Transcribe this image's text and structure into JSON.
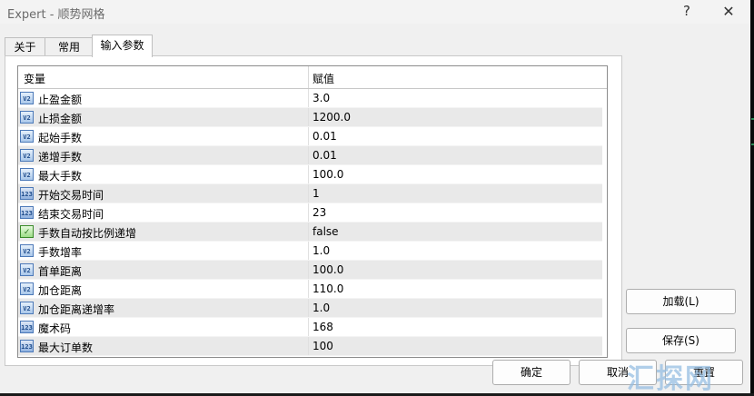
{
  "window": {
    "title": "Expert - 顺势网格",
    "help_glyph": "?",
    "close_glyph": "✕"
  },
  "tabs": [
    {
      "label": "关于"
    },
    {
      "label": "常用"
    },
    {
      "label": "输入参数",
      "active": true
    }
  ],
  "table": {
    "columns": [
      "变量",
      "赋值"
    ],
    "rows": [
      {
        "icon": "double-type-icon",
        "icon_text": "V2",
        "name": "止盈金额",
        "value": "3.0"
      },
      {
        "icon": "double-type-icon",
        "icon_text": "V2",
        "name": "止损金额",
        "value": "1200.0"
      },
      {
        "icon": "double-type-icon",
        "icon_text": "V2",
        "name": "起始手数",
        "value": "0.01"
      },
      {
        "icon": "double-type-icon",
        "icon_text": "V2",
        "name": "递增手数",
        "value": "0.01"
      },
      {
        "icon": "double-type-icon",
        "icon_text": "V2",
        "name": "最大手数",
        "value": "100.0"
      },
      {
        "icon": "integer-type-icon",
        "icon_text": "123",
        "name": "开始交易时间",
        "value": "1"
      },
      {
        "icon": "integer-type-icon",
        "icon_text": "123",
        "name": "结束交易时间",
        "value": "23"
      },
      {
        "icon": "bool-type-icon",
        "icon_text": "✓",
        "name": "手数自动按比例递增",
        "value": "false"
      },
      {
        "icon": "double-type-icon",
        "icon_text": "V2",
        "name": "手数增率",
        "value": "1.0"
      },
      {
        "icon": "double-type-icon",
        "icon_text": "V2",
        "name": "首单距离",
        "value": "100.0"
      },
      {
        "icon": "double-type-icon",
        "icon_text": "V2",
        "name": "加仓距离",
        "value": "110.0"
      },
      {
        "icon": "double-type-icon",
        "icon_text": "V2",
        "name": "加仓距离递增率",
        "value": "1.0"
      },
      {
        "icon": "integer-type-icon",
        "icon_text": "123",
        "name": "魔术码",
        "value": "168"
      },
      {
        "icon": "integer-type-icon",
        "icon_text": "123",
        "name": "最大订单数",
        "value": "100"
      }
    ]
  },
  "buttons": {
    "load": "加载(L)",
    "save": "保存(S)",
    "ok": "确定",
    "cancel": "取消",
    "reset": "重置"
  },
  "watermark": "汇探网",
  "colors": {
    "window_bg": "#f0f0f0",
    "alt_row": "#e9e9e9",
    "icon_blue": "#4c79b8",
    "icon_green": "#3a8a2a"
  }
}
